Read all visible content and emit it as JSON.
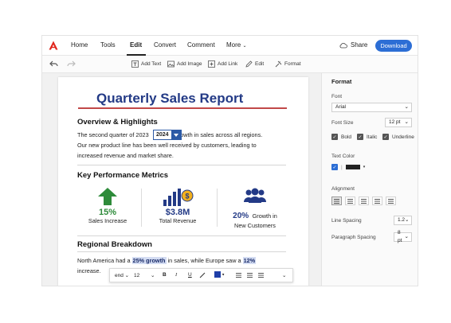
{
  "nav": {
    "items": [
      "Home",
      "Tools",
      "Edit",
      "Convert",
      "Comment",
      "More"
    ],
    "share": "Share",
    "download": "Download"
  },
  "edit_toolbar": {
    "add_text": "Add Text",
    "add_image": "Add Image",
    "add_link": "Add Link",
    "edit": "Edit",
    "format": "Format"
  },
  "document": {
    "title": "Quarterly Sales Report",
    "overview_heading": "Overview & Highlights",
    "overview_line1_a": "The second quarter of 2023",
    "year_value": "2024",
    "overview_line1_b": "h growth in sales across all regions.",
    "overview_line2": "Our new product line has been well received by customers, leading to",
    "overview_line3": "increased revenue and market share.",
    "kpi_heading": "Key Performance Metrics",
    "kpis": [
      {
        "value": "15%",
        "label": "Sales Increase"
      },
      {
        "value": "$3.8M",
        "label": "Total Revenue"
      },
      {
        "value": "20%",
        "label_a": "Growth in",
        "label_b": "New Customers"
      }
    ],
    "regional_heading": "Regional Breakdown",
    "regional_line1_a": "North America had a ",
    "regional_hl1": "25% growth",
    "regional_line1_b": " in sales, while Europe saw a ",
    "regional_hl2": "12%",
    "regional_line2": "increase."
  },
  "float_toolbar": {
    "font": "end",
    "size": "12",
    "bold": "B",
    "italic": "I",
    "underline": "U"
  },
  "panel": {
    "title": "Format",
    "font_label": "Font",
    "font_value": "Arial",
    "size_label": "Font Size",
    "size_value": "12 pt",
    "bold": "Bold",
    "italic": "Italic",
    "underline": "Underline",
    "color_label": "Text Color",
    "align_label": "Alignment",
    "line_spacing_label": "Line Spacing",
    "line_spacing_value": "1.2",
    "para_spacing_label": "Paragraph Spacing",
    "para_spacing_value": "8 pt"
  },
  "colors": {
    "accent": "#2c6ed5",
    "title": "#233a86",
    "green": "#2e8b3a",
    "rule": "#c14848"
  }
}
